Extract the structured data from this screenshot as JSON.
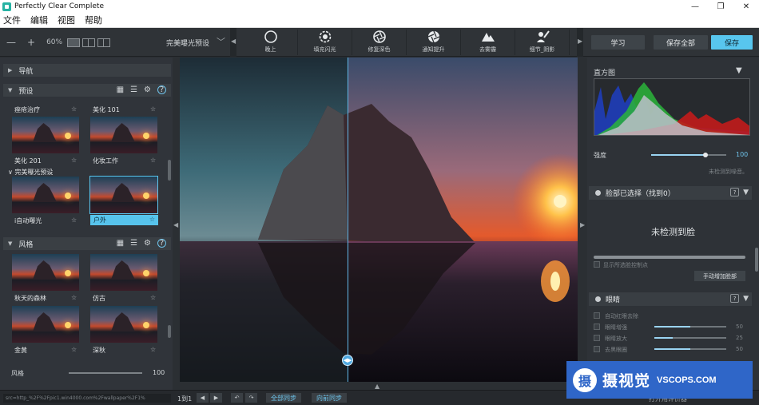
{
  "window": {
    "title": "Perfectly Clear Complete",
    "minimize": "—",
    "restore": "❐",
    "close": "✕"
  },
  "menu": [
    "文件",
    "编辑",
    "视图",
    "帮助"
  ],
  "toolbar": {
    "zoom_out": "—",
    "zoom_in": "+",
    "zoom_level": "60%",
    "preset_name": "完美曝光预设",
    "tools": [
      {
        "label": "晚上",
        "icon": "moon-face-icon"
      },
      {
        "label": "填充闪光",
        "icon": "flash-gear-icon"
      },
      {
        "label": "修复深色",
        "icon": "aperture-icon"
      },
      {
        "label": "通知提升",
        "icon": "aperture-plus-icon"
      },
      {
        "label": "去雾霾",
        "icon": "mountain-icon"
      },
      {
        "label": "细节_阴影",
        "icon": "brush-person-icon"
      }
    ],
    "learn": "学习",
    "save_all": "保存全部",
    "save": "保存"
  },
  "left": {
    "nav_title": "导航",
    "presets_title": "预设",
    "presets": [
      {
        "label": "痤疮治疗"
      },
      {
        "label": "美化 101"
      },
      {
        "label": "美化 201"
      },
      {
        "label": "化妆工作"
      },
      {
        "label": "i自动曝光"
      },
      {
        "label": "户外"
      }
    ],
    "sub_group": "完美曝光预设",
    "styles_title": "风格",
    "styles": [
      {
        "label": "秋天的森林"
      },
      {
        "label": "仿古"
      },
      {
        "label": "金黄"
      },
      {
        "label": "深秋"
      }
    ],
    "strength_label": "风格",
    "strength_value": "100",
    "star": "☆"
  },
  "right": {
    "histogram_title": "直方图",
    "strength_label": "强度",
    "strength_value": "100",
    "strength_fraction": 0.72,
    "noise_note": "未检测到噪音。",
    "face_title": "脸部已选择（找到0）",
    "no_face": "未检测到脸",
    "show_points": "显示所选脸控制点",
    "add_face": "手动增加脸部",
    "eyes_title": "眼睛",
    "eye_rows": [
      {
        "label": "自动红眼去除",
        "value": ""
      },
      {
        "label": "眼睛增强",
        "value": "50"
      },
      {
        "label": "眼睛放大",
        "value": "25"
      },
      {
        "label": "去黑眼圈",
        "value": "50"
      }
    ],
    "eye_fractions": [
      0,
      0.5,
      0.25,
      0.5
    ],
    "help": "?"
  },
  "status": {
    "source_url": "src=http_%2F%2Fpic1.win4000.com%2Fwallpaper%2F1%",
    "page": "1到1",
    "sync_all": "全部同步",
    "sync_forward": "向前同步",
    "right_text": "打开用评价器"
  },
  "watermark": {
    "logo": "摄",
    "text": "摄视觉",
    "url": "VSCOPS.COM"
  }
}
